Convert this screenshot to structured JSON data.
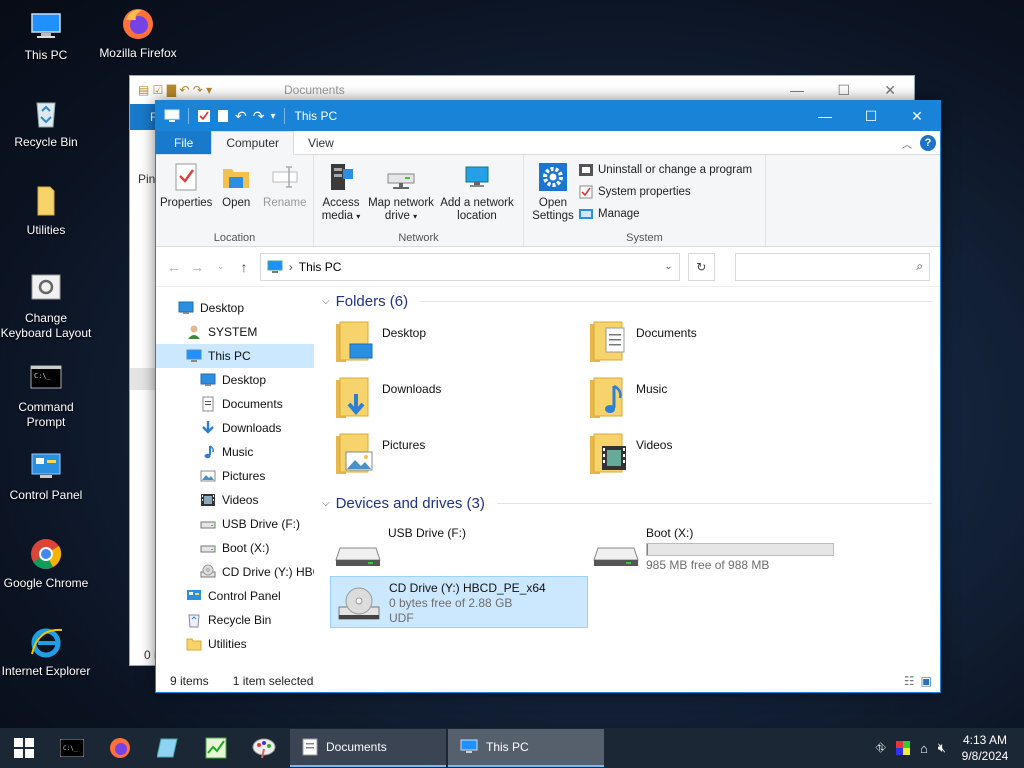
{
  "desktop": {
    "icons": [
      {
        "label": "This PC"
      },
      {
        "label": "Mozilla Firefox"
      },
      {
        "label": "Recycle Bin"
      },
      {
        "label": "Utilities"
      },
      {
        "label": "Change Keyboard Layout"
      },
      {
        "label": "Command Prompt"
      },
      {
        "label": "Control Panel"
      },
      {
        "label": "Google Chrome"
      },
      {
        "label": "Internet Explorer"
      }
    ]
  },
  "bg_window": {
    "title": "Documents",
    "sidebar_partial_top": "Pin",
    "sidebar_partial_tab": "F",
    "status_partial": "0 i"
  },
  "window": {
    "title": "This PC",
    "tabs": {
      "file": "File",
      "computer": "Computer",
      "view": "View"
    },
    "help": "?",
    "ribbon": {
      "location": {
        "label": "Location",
        "properties": "Properties",
        "open": "Open",
        "rename": "Rename"
      },
      "network": {
        "label": "Network",
        "access_media_1": "Access",
        "access_media_2": "media",
        "map_drive_1": "Map network",
        "map_drive_2": "drive",
        "add_location_1": "Add a network",
        "add_location_2": "location"
      },
      "system": {
        "label": "System",
        "open_settings_1": "Open",
        "open_settings_2": "Settings",
        "uninstall": "Uninstall or change a program",
        "system_properties": "System properties",
        "manage": "Manage"
      }
    },
    "address": {
      "path": "This PC",
      "search_placeholder": ""
    },
    "nav": [
      {
        "label": "Desktop",
        "icon": "desktop-icon",
        "indent": 0
      },
      {
        "label": "SYSTEM",
        "icon": "user-icon",
        "indent": 0
      },
      {
        "label": "This PC",
        "icon": "computer-icon",
        "indent": 0,
        "selected": true
      },
      {
        "label": "Desktop",
        "icon": "desktop-icon",
        "indent": 1
      },
      {
        "label": "Documents",
        "icon": "documents-icon",
        "indent": 1
      },
      {
        "label": "Downloads",
        "icon": "download-icon",
        "indent": 1
      },
      {
        "label": "Music",
        "icon": "music-icon",
        "indent": 1
      },
      {
        "label": "Pictures",
        "icon": "pictures-icon",
        "indent": 1
      },
      {
        "label": "Videos",
        "icon": "videos-icon",
        "indent": 1
      },
      {
        "label": "USB Drive (F:)",
        "icon": "drive-icon",
        "indent": 1
      },
      {
        "label": "Boot (X:)",
        "icon": "drive-icon",
        "indent": 1
      },
      {
        "label": "CD Drive (Y:) HBC",
        "icon": "cd-drive-icon",
        "indent": 1
      },
      {
        "label": "Control Panel",
        "icon": "control-panel-icon",
        "indent": 0
      },
      {
        "label": "Recycle Bin",
        "icon": "recycle-bin-icon",
        "indent": 0
      },
      {
        "label": "Utilities",
        "icon": "folder-icon",
        "indent": 0
      }
    ],
    "folders_header": "Folders (6)",
    "folders": [
      {
        "label": "Desktop",
        "overlay": "desktop"
      },
      {
        "label": "Documents",
        "overlay": "documents"
      },
      {
        "label": "Downloads",
        "overlay": "downloads"
      },
      {
        "label": "Music",
        "overlay": "music"
      },
      {
        "label": "Pictures",
        "overlay": "pictures"
      },
      {
        "label": "Videos",
        "overlay": "videos"
      }
    ],
    "drives_header": "Devices and drives (3)",
    "drives": [
      {
        "label": "USB Drive (F:)",
        "line2": "",
        "line3": "",
        "kind": "usb"
      },
      {
        "label": "Boot (X:)",
        "line2": "985 MB free of 988 MB",
        "line3": "",
        "kind": "hdd",
        "used_fraction": 0.003
      },
      {
        "label": "CD Drive (Y:) HBCD_PE_x64",
        "line2": "0 bytes free of 2.88 GB",
        "line3": "UDF",
        "kind": "cd",
        "selected": true
      }
    ],
    "status": {
      "items": "9 items",
      "selected": "1 item selected"
    }
  },
  "taskbar": {
    "apps": [
      {
        "label": "Documents"
      },
      {
        "label": "This PC"
      }
    ],
    "time": "4:13 AM",
    "date": "9/8/2024"
  }
}
